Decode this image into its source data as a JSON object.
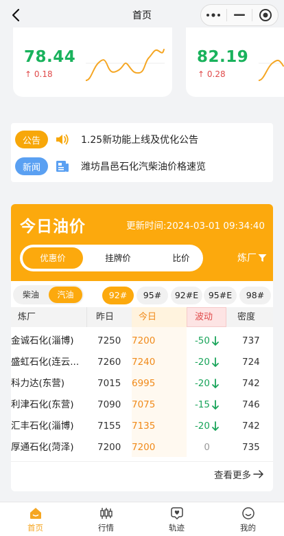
{
  "nav": {
    "title": "首页"
  },
  "price_cards": [
    {
      "value": "78.44",
      "delta": "0.18"
    },
    {
      "value": "82.19",
      "delta": "0.28"
    }
  ],
  "notices": [
    {
      "tag": "公告",
      "text": "1.25新功能上线及优化公告"
    },
    {
      "tag": "新闻",
      "text": "潍坊昌邑石化汽柴油价格速览"
    }
  ],
  "oil": {
    "title": "今日油价",
    "updated": "更新时间:2024-03-01 09:34:40",
    "price_tabs": [
      "优惠价",
      "挂牌价",
      "比价"
    ],
    "factory_filter": "炼厂",
    "fuel_tabs": [
      "柴油",
      "汽油"
    ],
    "grades": [
      "92#",
      "95#",
      "92#E",
      "95#E",
      "98#"
    ],
    "columns": [
      "炼厂",
      "昨日",
      "今日",
      "波动",
      "密度"
    ],
    "rows": [
      {
        "name": "金诚石化(淄博)",
        "yesterday": "7250",
        "today": "7200",
        "diff": "-50",
        "density": "737"
      },
      {
        "name": "盛虹石化(连云...",
        "yesterday": "7260",
        "today": "7240",
        "diff": "-20",
        "density": "724"
      },
      {
        "name": "科力达(东营)",
        "yesterday": "7015",
        "today": "6995",
        "diff": "-20",
        "density": "742"
      },
      {
        "name": "利津石化(东营)",
        "yesterday": "7090",
        "today": "7075",
        "diff": "-15",
        "density": "746"
      },
      {
        "name": "汇丰石化(淄博)",
        "yesterday": "7155",
        "today": "7135",
        "diff": "-20",
        "density": "742"
      },
      {
        "name": "厚通石化(菏泽)",
        "yesterday": "7200",
        "today": "7200",
        "diff": "0",
        "density": "735"
      }
    ],
    "more": "查看更多"
  },
  "tabbar": [
    {
      "label": "首页",
      "icon": "home-icon",
      "active": true
    },
    {
      "label": "行情",
      "icon": "candlestick-icon",
      "active": false
    },
    {
      "label": "轨迹",
      "icon": "track-icon",
      "active": false
    },
    {
      "label": "我的",
      "icon": "profile-icon",
      "active": false
    }
  ],
  "colors": {
    "accent": "#fca90d",
    "up_green": "#19b25c",
    "down_red": "#e04a4a",
    "tag_blue": "#5aa0f2"
  }
}
